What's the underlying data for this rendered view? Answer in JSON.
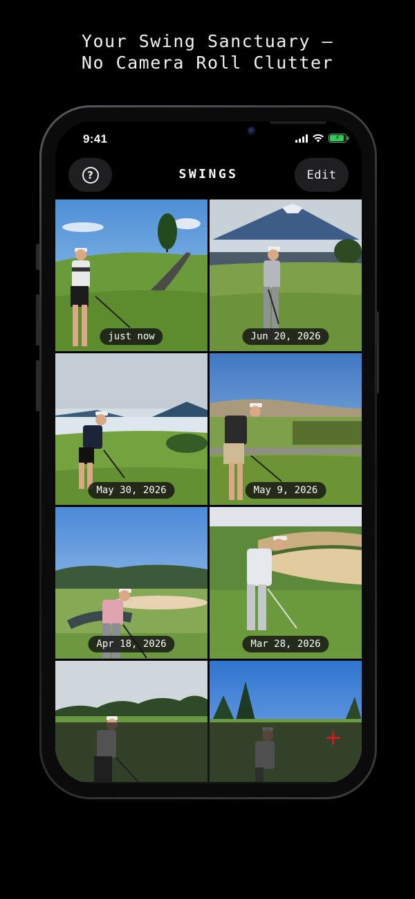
{
  "headline": {
    "line1": "Your Swing Sanctuary —",
    "line2": "No Camera Roll Clutter"
  },
  "status_bar": {
    "time": "9:41",
    "battery_level": 0.85,
    "icons": [
      "signal-icon",
      "wifi-icon",
      "battery-charging-icon"
    ]
  },
  "nav": {
    "help_icon": "question-circle-icon",
    "help_glyph": "?",
    "title": "SWINGS",
    "edit_label": "Edit"
  },
  "swings": [
    {
      "date": "just now",
      "scene": "tree-hill"
    },
    {
      "date": "Jun 20, 2026",
      "scene": "mountain"
    },
    {
      "date": "May 30, 2026",
      "scene": "lake"
    },
    {
      "date": "May 9, 2026",
      "scene": "vineyard"
    },
    {
      "date": "Apr 18, 2026",
      "scene": "bunker-course"
    },
    {
      "date": "Mar 28, 2026",
      "scene": "sand-bunker"
    },
    {
      "date": "",
      "scene": "treeline"
    },
    {
      "date": "",
      "scene": "pine"
    }
  ],
  "bottom_bar": {
    "add_icon": "plus-icon",
    "add_glyph": "+"
  },
  "colors": {
    "background": "#000000",
    "accent_red": "#e0191d",
    "battery_green": "#34c759"
  }
}
